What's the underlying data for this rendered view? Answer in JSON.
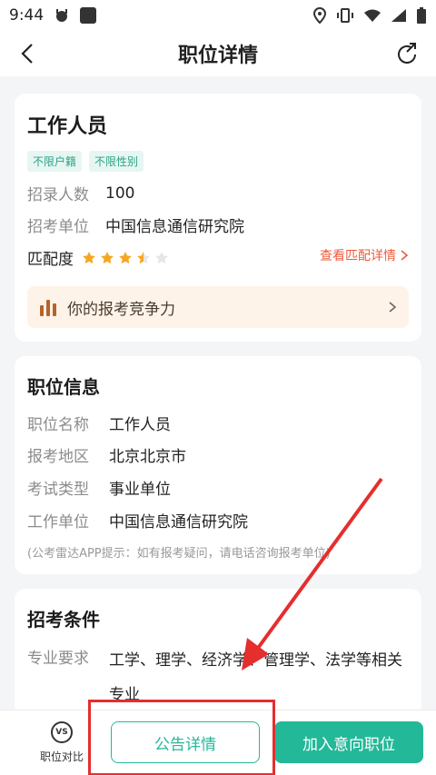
{
  "status_bar": {
    "time": "9:44"
  },
  "nav": {
    "title": "职位详情"
  },
  "summary": {
    "job_title": "工作人员",
    "tags": [
      "不限户籍",
      "不限性别"
    ],
    "recruit_count_label": "招录人数",
    "recruit_count_value": "100",
    "unit_label": "招考单位",
    "unit_value": "中国信息通信研究院",
    "match_label": "匹配度",
    "match_rating": 3.5,
    "match_max": 5,
    "match_link": "查看匹配详情",
    "compete_label": "你的报考竞争力"
  },
  "position_info": {
    "title": "职位信息",
    "rows": [
      {
        "label": "职位名称",
        "value": "工作人员"
      },
      {
        "label": "报考地区",
        "value": "北京北京市"
      },
      {
        "label": "考试类型",
        "value": "事业单位"
      },
      {
        "label": "工作单位",
        "value": "中国信息通信研究院"
      }
    ],
    "hint": "(公考雷达APP提示：如有报考疑问，请电话咨询报考单位)"
  },
  "conditions": {
    "title": "招考条件",
    "major_label": "专业要求",
    "major_value": "工学、理学、经济学、管理学、法学等相关专业"
  },
  "bottom_bar": {
    "compare_label": "职位对比",
    "compare_icon_text": "VS",
    "notice_button": "公告详情",
    "add_button": "加入意向职位"
  },
  "colors": {
    "accent": "#23b898",
    "highlight": "#e52e2e",
    "star": "#f5a623",
    "link": "#ee5a3c"
  }
}
